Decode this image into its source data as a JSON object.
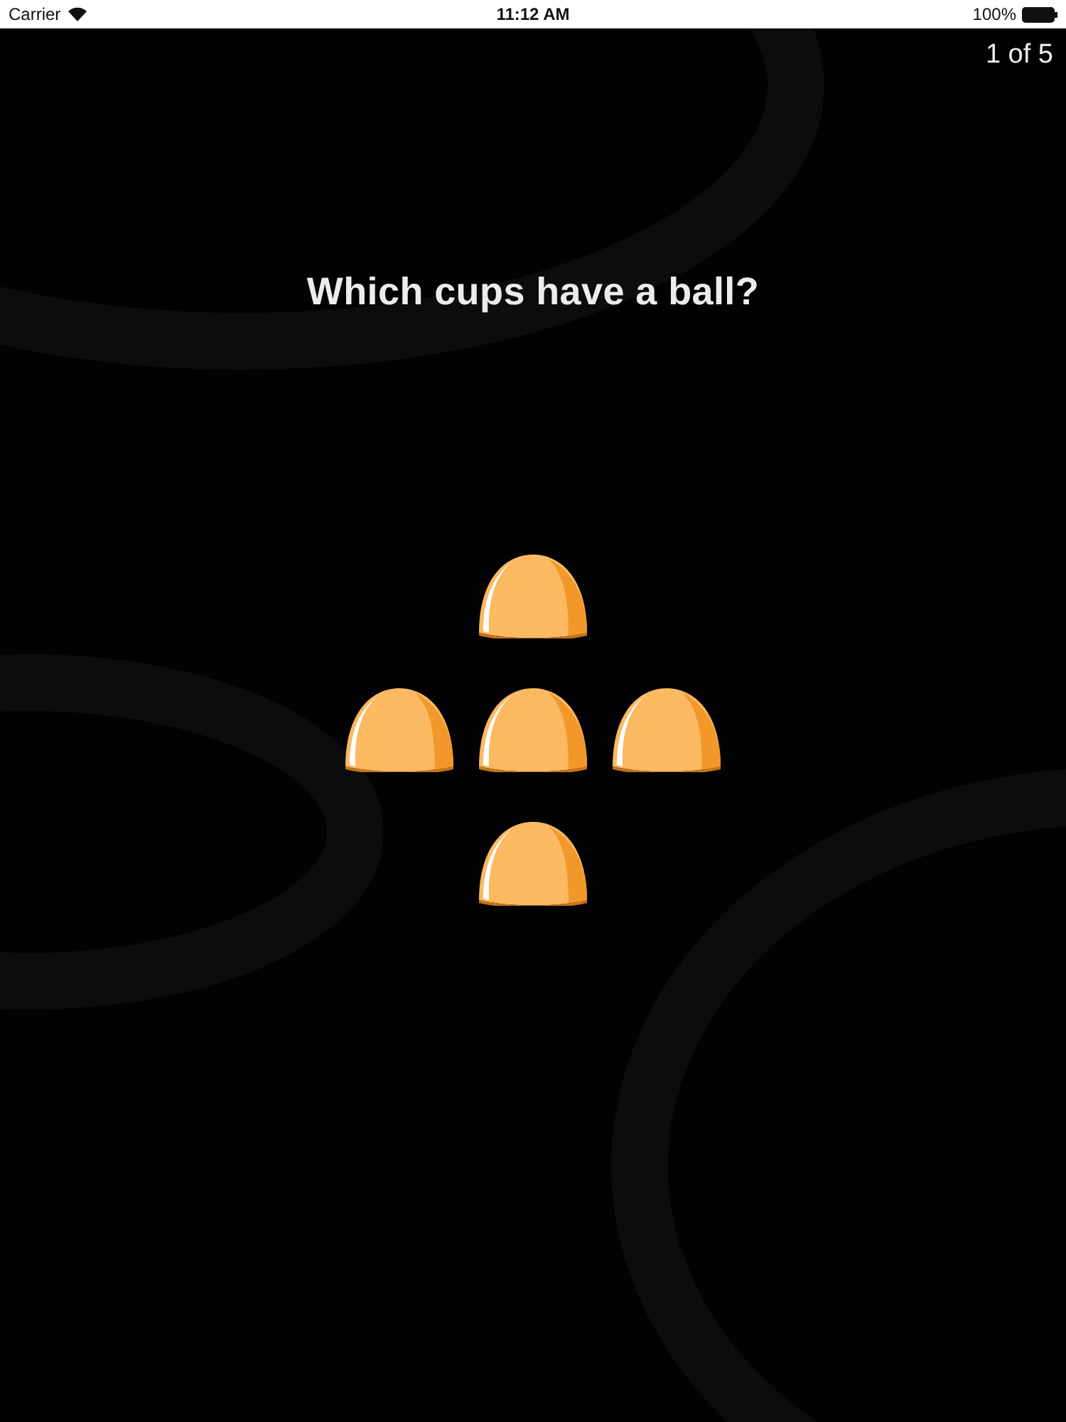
{
  "status_bar": {
    "carrier": "Carrier",
    "time": "11:12 AM",
    "battery": "100%"
  },
  "progress": "1 of 5",
  "question": "Which cups have a ball?",
  "cup_rows": [
    {
      "cups": [
        {
          "kind": "cup"
        }
      ]
    },
    {
      "cups": [
        {
          "kind": "cup"
        },
        {
          "kind": "cup"
        },
        {
          "kind": "cup"
        }
      ]
    },
    {
      "cups": [
        {
          "kind": "cup"
        }
      ]
    }
  ]
}
